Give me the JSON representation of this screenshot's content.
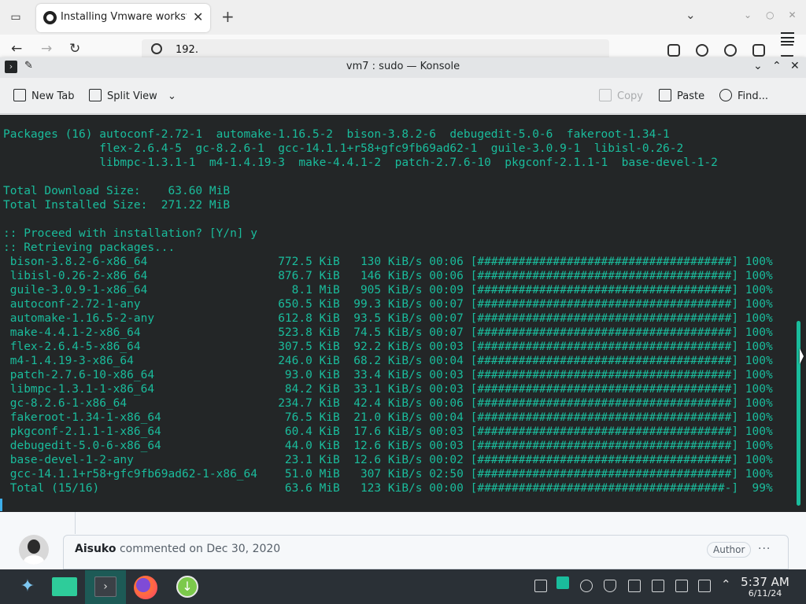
{
  "browser": {
    "tab_title": "Installing Vmware workstation",
    "url": "192."
  },
  "konsole": {
    "title": "vm7 : sudo — Konsole",
    "toolbar": {
      "new_tab": "New Tab",
      "split_view": "Split View",
      "copy": "Copy",
      "paste": "Paste",
      "find": "Find..."
    },
    "terminal_text": "Packages (16) autoconf-2.72-1  automake-1.16.5-2  bison-3.8.2-6  debugedit-5.0-6  fakeroot-1.34-1\n              flex-2.6.4-5  gc-8.2.6-1  gcc-14.1.1+r58+gfc9fb69ad62-1  guile-3.0.9-1  libisl-0.26-2\n              libmpc-1.3.1-1  m4-1.4.19-3  make-4.4.1-2  patch-2.7.6-10  pkgconf-2.1.1-1  base-devel-1-2\n\nTotal Download Size:    63.60 MiB\nTotal Installed Size:  271.22 MiB\n\n:: Proceed with installation? [Y/n] y\n:: Retrieving packages...\n bison-3.8.2-6-x86_64                   772.5 KiB   130 KiB/s 00:06 [#####################################] 100%\n libisl-0.26-2-x86_64                   876.7 KiB   146 KiB/s 00:06 [#####################################] 100%\n guile-3.0.9-1-x86_64                     8.1 MiB   905 KiB/s 00:09 [#####################################] 100%\n autoconf-2.72-1-any                    650.5 KiB  99.3 KiB/s 00:07 [#####################################] 100%\n automake-1.16.5-2-any                  612.8 KiB  93.5 KiB/s 00:07 [#####################################] 100%\n make-4.4.1-2-x86_64                    523.8 KiB  74.5 KiB/s 00:07 [#####################################] 100%\n flex-2.6.4-5-x86_64                    307.5 KiB  92.2 KiB/s 00:03 [#####################################] 100%\n m4-1.4.19-3-x86_64                     246.0 KiB  68.2 KiB/s 00:04 [#####################################] 100%\n patch-2.7.6-10-x86_64                   93.0 KiB  33.4 KiB/s 00:03 [#####################################] 100%\n libmpc-1.3.1-1-x86_64                   84.2 KiB  33.1 KiB/s 00:03 [#####################################] 100%\n gc-8.2.6-1-x86_64                      234.7 KiB  42.4 KiB/s 00:06 [#####################################] 100%\n fakeroot-1.34-1-x86_64                  76.5 KiB  21.0 KiB/s 00:04 [#####################################] 100%\n pkgconf-2.1.1-1-x86_64                  60.4 KiB  17.6 KiB/s 00:03 [#####################################] 100%\n debugedit-5.0-6-x86_64                  44.0 KiB  12.6 KiB/s 00:03 [#####################################] 100%\n base-devel-1-2-any                      23.1 KiB  12.6 KiB/s 00:02 [#####################################] 100%\n gcc-14.1.1+r58+gfc9fb69ad62-1-x86_64    51.0 MiB   307 KiB/s 02:50 [#####################################] 100%\n Total (15/16)                           63.6 MiB   123 KiB/s 00:00 [####################################-]  99%"
  },
  "github_comment": {
    "author": "Aisuko",
    "action": "commented on",
    "date": "Dec 30, 2020",
    "badge": "Author",
    "more": "···"
  },
  "taskbar": {
    "time": "5:37 AM",
    "date": "6/11/24"
  }
}
